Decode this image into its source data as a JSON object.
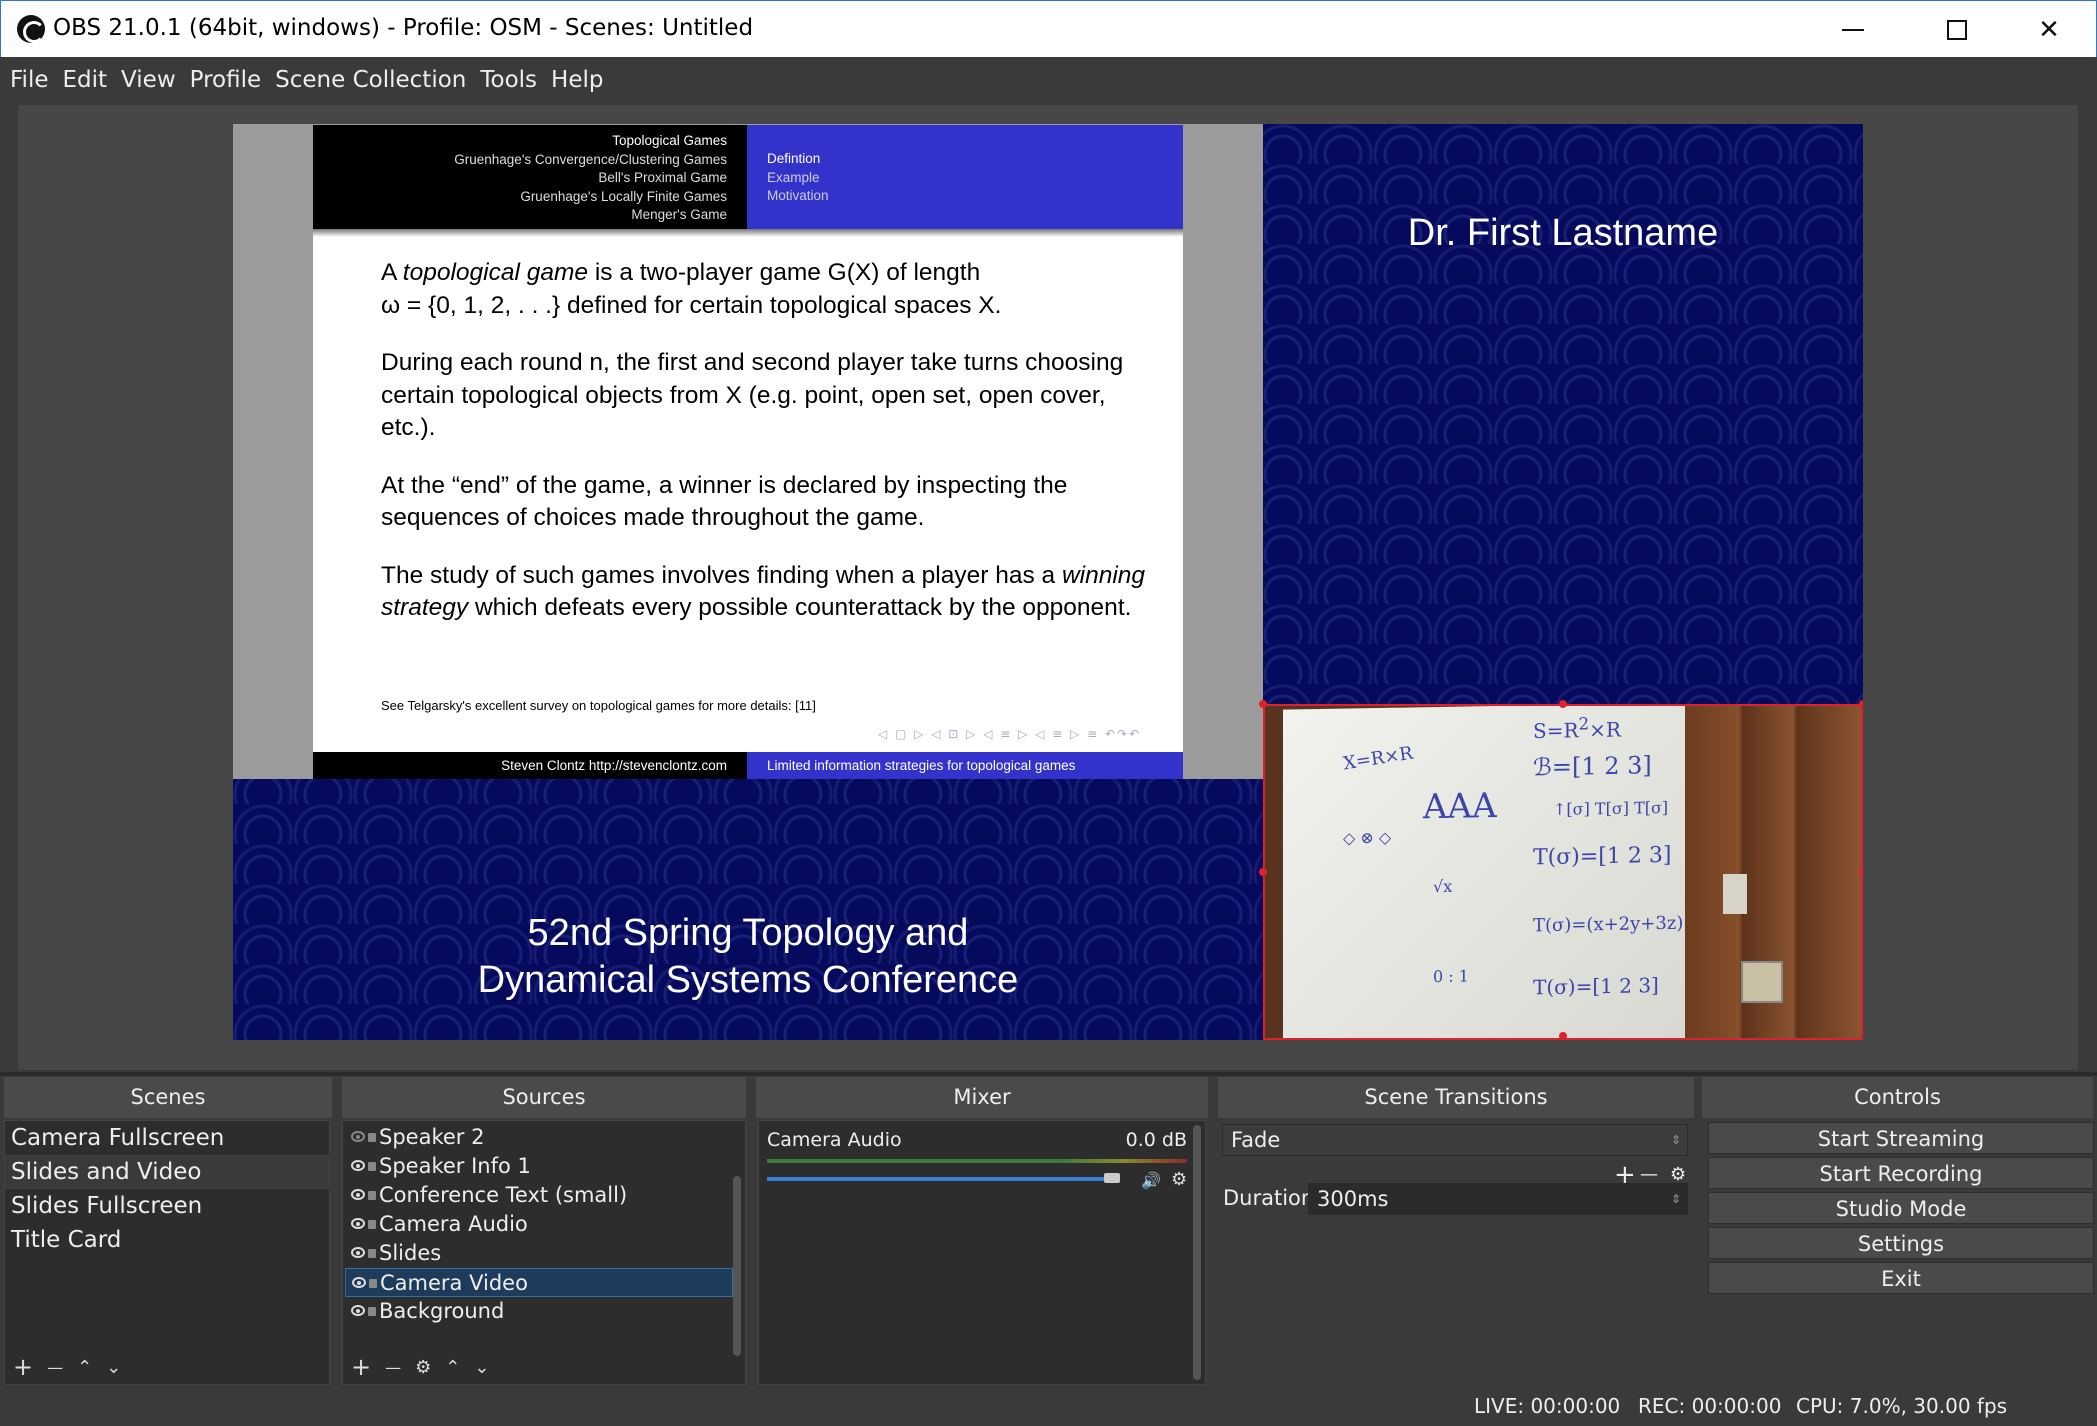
{
  "window": {
    "title": "OBS 21.0.1 (64bit, windows) - Profile: OSM - Scenes: Untitled",
    "minimize": "",
    "maximize": "",
    "close": "✕"
  },
  "menu": [
    "File",
    "Edit",
    "View",
    "Profile",
    "Scene Collection",
    "Tools",
    "Help"
  ],
  "preview": {
    "slide": {
      "nav_left": [
        "Topological Games",
        "Gruenhage's Convergence/Clustering Games",
        "Bell's Proximal Game",
        "Gruenhage's Locally Finite Games",
        "Menger's Game"
      ],
      "nav_right": [
        "Defintion",
        "Example",
        "Motivation"
      ],
      "paragraph1_a": "A ",
      "paragraph1_em": "topological game",
      "paragraph1_b": " is a two-player game G(X) of length",
      "paragraph1_c": "ω = {0, 1, 2, . . .} defined for certain topological spaces X.",
      "paragraph2": "During each round n, the first and second player take turns choosing certain topological objects from X (e.g. point, open set, open cover, etc.).",
      "paragraph3": "At the “end” of the game, a winner is declared by inspecting the sequences of choices made throughout the game.",
      "paragraph4_a": "The study of such games involves finding when a player has a ",
      "paragraph4_em": "winning strategy",
      "paragraph4_b": " which defeats every possible counterattack by the opponent.",
      "footnote": "See Telgarsky's excellent survey on topological games for more details: [11]",
      "nav_symbols": "◁ ▢ ▷ ◁ ⊡ ▷ ◁ ≡ ▷ ◁ ≡ ▷   ≡   ↶↷↶",
      "footer_left": "Steven Clontz http://stevenclontz.com",
      "footer_right": "Limited information strategies for topological games"
    },
    "speaker_name": "Dr. First Lastname",
    "conference_line1": "52nd Spring Topology and",
    "conference_line2": "Dynamical Systems Conference"
  },
  "docks": {
    "scenes": {
      "title": "Scenes",
      "items": [
        "Camera Fullscreen",
        "Slides and Video",
        "Slides Fullscreen",
        "Title Card"
      ],
      "selected": "Slides and Video",
      "toolbar": [
        "+",
        "—",
        "⌃",
        "⌄"
      ]
    },
    "sources": {
      "title": "Sources",
      "items": [
        {
          "label": "Speaker 2",
          "visible": false
        },
        {
          "label": "Speaker Info 1",
          "visible": true
        },
        {
          "label": "Conference Text (small)",
          "visible": true
        },
        {
          "label": "Camera Audio",
          "visible": true
        },
        {
          "label": "Slides",
          "visible": true
        },
        {
          "label": "Camera Video",
          "visible": true
        },
        {
          "label": "Background",
          "visible": true
        }
      ],
      "selected": "Camera Video",
      "toolbar": [
        "+",
        "—",
        "⚙",
        "⌃",
        "⌄"
      ]
    },
    "mixer": {
      "title": "Mixer",
      "channel": "Camera Audio",
      "level": "0.0 dB",
      "volume_fraction": 0.96
    },
    "transitions": {
      "title": "Scene Transitions",
      "selected": "Fade",
      "duration_label": "Duration",
      "duration_value": "300ms",
      "toolbar": [
        "+",
        "—",
        "⚙"
      ]
    },
    "controls": {
      "title": "Controls",
      "buttons": [
        "Start Streaming",
        "Start Recording",
        "Studio Mode",
        "Settings",
        "Exit"
      ]
    }
  },
  "status": {
    "live": "LIVE: 00:00:00",
    "rec": "REC: 00:00:00",
    "cpu": "CPU: 7.0%, 30.00 fps"
  },
  "colors": {
    "accent": "#3b7fd4",
    "slide_blue": "#3333cc",
    "background_navy": "#050a5c",
    "selection_red": "#e0202a"
  }
}
